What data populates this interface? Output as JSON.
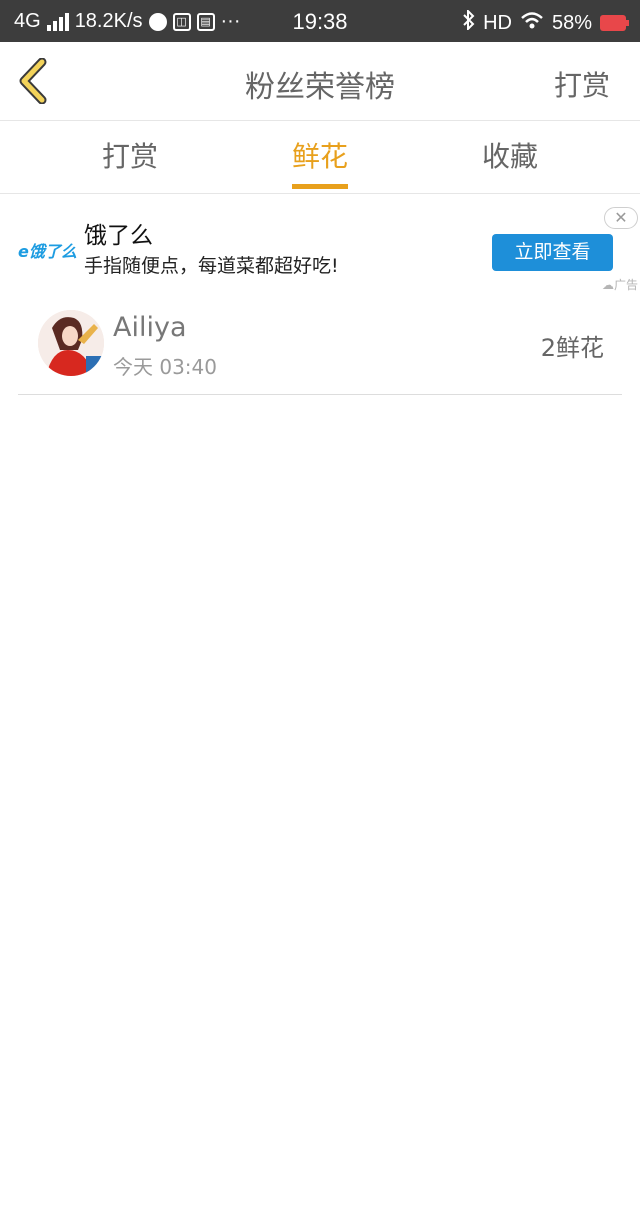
{
  "status_bar": {
    "network": "4G",
    "speed": "18.2K/s",
    "time": "19:38",
    "hd": "HD",
    "battery": "58%",
    "more": "···"
  },
  "header": {
    "title": "粉丝荣誉榜",
    "action": "打赏"
  },
  "tabs": [
    {
      "label": "打赏",
      "active": false
    },
    {
      "label": "鲜花",
      "active": true
    },
    {
      "label": "收藏",
      "active": false
    }
  ],
  "ad": {
    "logo": "e饿了么",
    "title": "饿了么",
    "description": "手指随便点，每道菜都超好吃!",
    "button": "立即查看",
    "tag": "广告",
    "close": "✕"
  },
  "list": [
    {
      "name": "Ailiya",
      "time": "今天 03:40",
      "count": "2鲜花"
    }
  ],
  "colors": {
    "accent": "#e8a01c",
    "ad_button": "#1e8fd9",
    "status_bar": "#3d3d3d"
  }
}
